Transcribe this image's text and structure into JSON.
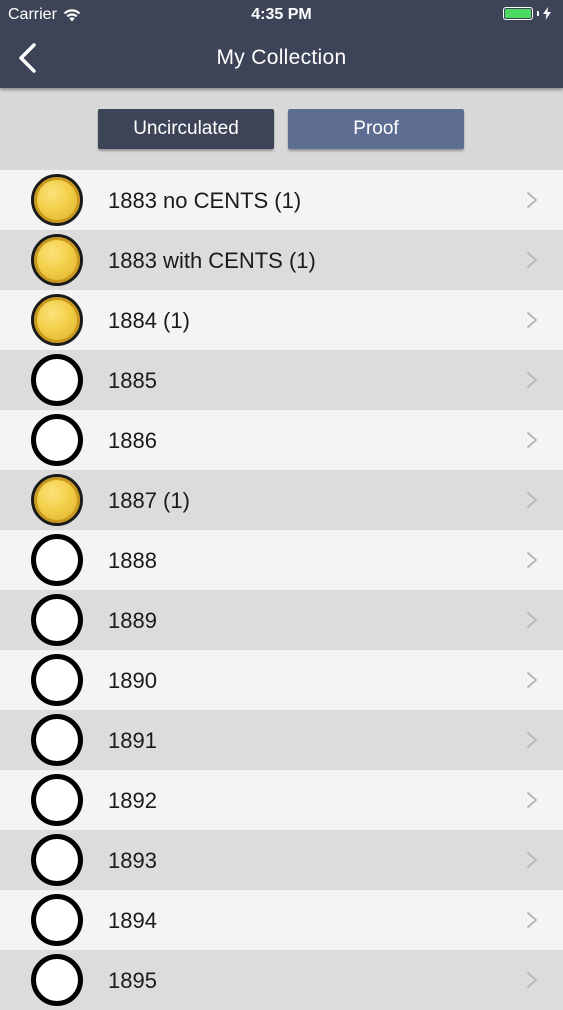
{
  "status": {
    "carrier": "Carrier",
    "time": "4:35 PM",
    "wifi_icon": "wifi-icon",
    "battery_icon": "battery-icon",
    "battery_color": "#4cd964"
  },
  "nav": {
    "title": "My Collection",
    "back_icon": "chevron-left-icon"
  },
  "segments": {
    "uncirculated": "Uncirculated",
    "proof": "Proof",
    "selected": "Uncirculated"
  },
  "colors": {
    "nav_bg": "#3e4458",
    "segment_selected": "#3e4458",
    "segment_unselected": "#5e6e92",
    "coin_gold": "#f2cd46"
  },
  "items": [
    {
      "label": "1883 no CENTS (1)",
      "owned": true
    },
    {
      "label": "1883 with CENTS (1)",
      "owned": true
    },
    {
      "label": "1884 (1)",
      "owned": true
    },
    {
      "label": "1885",
      "owned": false
    },
    {
      "label": "1886",
      "owned": false
    },
    {
      "label": "1887 (1)",
      "owned": true
    },
    {
      "label": "1888",
      "owned": false
    },
    {
      "label": "1889",
      "owned": false
    },
    {
      "label": "1890",
      "owned": false
    },
    {
      "label": "1891",
      "owned": false
    },
    {
      "label": "1892",
      "owned": false
    },
    {
      "label": "1893",
      "owned": false
    },
    {
      "label": "1894",
      "owned": false
    },
    {
      "label": "1895",
      "owned": false
    }
  ]
}
